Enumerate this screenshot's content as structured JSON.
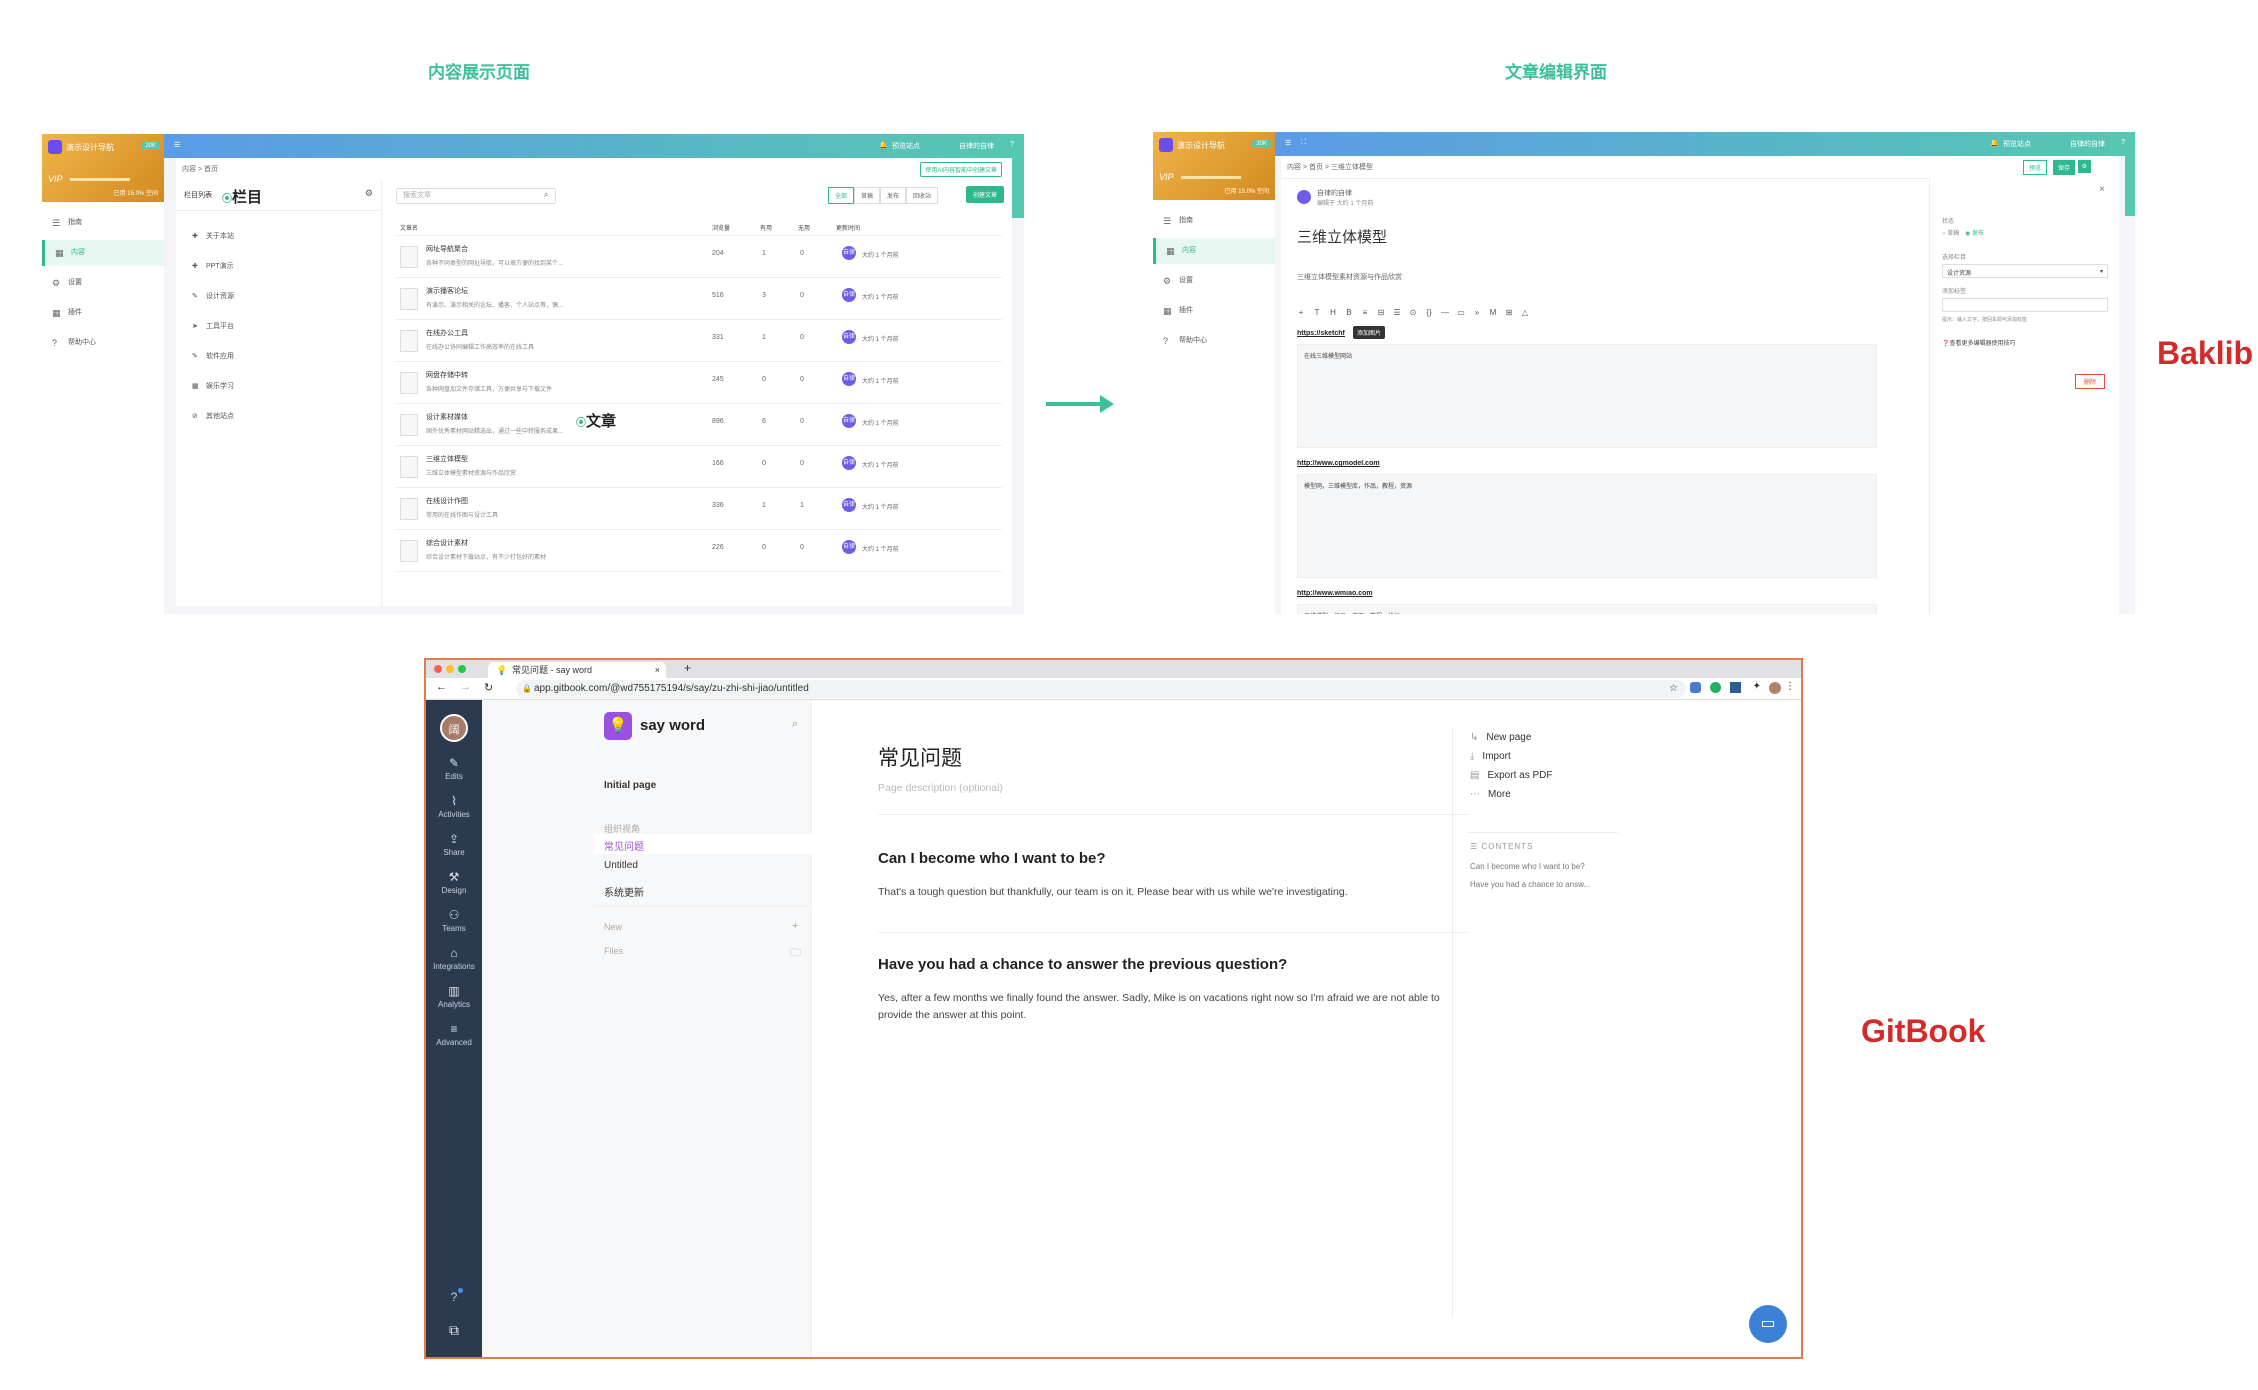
{
  "captions": {
    "left": "内容展示页面",
    "right": "文章编辑界面"
  },
  "brands": {
    "baklib": "Baklib",
    "gitbook": "GitBook"
  },
  "baklib_list": {
    "site_name": "演示设计导航",
    "plan_badge": "20K",
    "vip": "VIP",
    "quota": "已用 15.0% 空间",
    "nav": [
      {
        "icon": "☰",
        "label": "指南"
      },
      {
        "icon": "▦",
        "label": "内容"
      },
      {
        "icon": "⚙",
        "label": "设置"
      },
      {
        "icon": "▦",
        "label": "插件"
      },
      {
        "icon": "?",
        "label": "帮助中心"
      }
    ],
    "top_right": {
      "preview": "预览站点",
      "user": "自律的自律"
    },
    "breadcrumb": "内容 > 首页",
    "import_btn": "使用AI内容智能中创建文章",
    "columns_title": "栏目列表",
    "annot_column": "栏目",
    "annot_article": "文章",
    "columns": [
      "关于本站",
      "PPT演示",
      "设计资源",
      "工具平台",
      "软件应用",
      "娱乐学习",
      "其他站点"
    ],
    "column_icons": [
      "✚",
      "✚",
      "✎",
      "➤",
      "✎",
      "▦",
      "⊘"
    ],
    "search_placeholder": "搜索文章",
    "filters": [
      "全部",
      "草稿",
      "发布",
      "回收站"
    ],
    "create_btn": "创建文章",
    "headers": {
      "name": "文章名",
      "views": "浏览量",
      "useful": "有用",
      "useless": "无用",
      "updated": "更新时间"
    },
    "rows": [
      {
        "name": "网址导航聚合",
        "desc": "各种不同类型的网址导航，可以很方便的找到某个...",
        "views": "204",
        "useful": "1",
        "useless": "0",
        "time": "大约 1 个月前"
      },
      {
        "name": "演示播客论坛",
        "desc": "有演示、演示相关的论坛、播客、个人站点等，偶...",
        "views": "516",
        "useful": "3",
        "useless": "0",
        "time": "大约 1 个月前"
      },
      {
        "name": "在线办公工具",
        "desc": "在线办公协同编辑工作高效率的在线工具",
        "views": "331",
        "useful": "1",
        "useless": "0",
        "time": "大约 1 个月前"
      },
      {
        "name": "网盘存储中转",
        "desc": "各种网盘加文件存储工具，方便共享与下载文件",
        "views": "245",
        "useful": "0",
        "useless": "0",
        "time": "大约 1 个月前"
      },
      {
        "name": "设计素材媒体",
        "desc": "国外优秀素材网站精选出，通过一些中转服务成果...",
        "views": "896",
        "useful": "6",
        "useless": "0",
        "time": "大约 1 个月前"
      },
      {
        "name": "三维立体模型",
        "desc": "三维立体模型素材资源与作品欣赏",
        "views": "166",
        "useful": "0",
        "useless": "0",
        "time": "大约 1 个月前"
      },
      {
        "name": "在线设计作图",
        "desc": "常用的在线作图与设计工具",
        "views": "336",
        "useful": "1",
        "useless": "1",
        "time": "大约 1 个月前"
      },
      {
        "name": "综合设计素材",
        "desc": "综合设计素材下载站点，有不少打包好的素材",
        "views": "226",
        "useful": "0",
        "useless": "0",
        "time": "大约 1 个月前"
      }
    ],
    "avatar_initials": "自律"
  },
  "baklib_editor": {
    "breadcrumb": "内容 > 首页 > 三维立体模型",
    "author": "自律的自律",
    "author_sub": "编辑于 大约 1 个月前",
    "title": "三维立体模型",
    "summary": "三维立体模型素材资源与作品欣赏",
    "buttons": {
      "preview": "预览",
      "save": "保存"
    },
    "toolbar": [
      "+",
      "T",
      "H",
      "B",
      "≡",
      "⊟",
      "☰",
      "⊙",
      "{}",
      "—",
      "▭",
      "»",
      "M",
      "⊞",
      "△"
    ],
    "tooltip": "添加图片",
    "blocks": [
      {
        "link": "https://sketchfab.com",
        "note": "在线三维模型网站"
      },
      {
        "link": "http://www.cgmodel.com",
        "note": "模型网，三维模型库，作品，教程，资源"
      },
      {
        "link": "http://www.wmiao.com",
        "note": "三维模型、作品、资源、教程、论坛"
      }
    ],
    "panel": {
      "status_label": "状态",
      "status_opts": [
        "草稿",
        "发布"
      ],
      "column_label": "选择栏目",
      "column_value": "设计资源",
      "tags_label": "添加标签",
      "tags_hint": "提示：输入文字，按回车即可添加标签",
      "help": "查看更多编辑器使用技巧",
      "delete": "删除"
    }
  },
  "gitbook": {
    "tab_title": "常见问题 - say word",
    "url": "app.gitbook.com/@wd755175194/s/say/zu-zhi-shi-jiao/untitled",
    "rail_avatar": "阔",
    "rail": [
      {
        "icon": "✎",
        "label": "Edits"
      },
      {
        "icon": "⌇",
        "label": "Activities"
      },
      {
        "icon": "⇪",
        "label": "Share"
      },
      {
        "icon": "⚒",
        "label": "Design"
      },
      {
        "icon": "⚇",
        "label": "Teams"
      },
      {
        "icon": "⌂",
        "label": "Integrations"
      },
      {
        "icon": "▥",
        "label": "Analytics"
      },
      {
        "icon": "≡",
        "label": "Advanced"
      }
    ],
    "space_name": "say word",
    "pages": {
      "initial": "Initial page",
      "group": "组织视角",
      "items": [
        "常见问题",
        "Untitled",
        "系统更新"
      ],
      "new": "New",
      "files": "Files"
    },
    "page_title": "常见问题",
    "page_desc": "Page description (optional)",
    "sections": [
      {
        "q": "Can I become who I want to be?",
        "a": "That's a tough question but thankfully, our team is on it. Please bear with us while we're investigating."
      },
      {
        "q": "Have you had a chance to answer the previous question?",
        "a": "Yes, after a few months we finally found the answer. Sadly, Mike is on vacations right now so I'm afraid we are not able to provide the answer at this point."
      }
    ],
    "actions": [
      {
        "icon": "↳",
        "label": "New page"
      },
      {
        "icon": "⤓",
        "label": "Import"
      },
      {
        "icon": "▤",
        "label": "Export as PDF"
      },
      {
        "icon": "⋯",
        "label": "More"
      }
    ],
    "contents_title": "CONTENTS",
    "contents": [
      "Can I become who I want to be?",
      "Have you had a chance to answ..."
    ]
  }
}
